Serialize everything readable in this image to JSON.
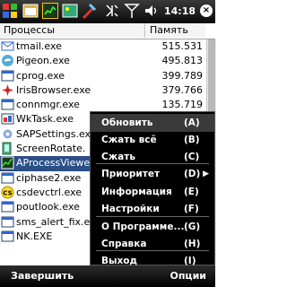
{
  "status_bar": {
    "time": "14:18",
    "close_glyph": "×"
  },
  "header": {
    "col_process": "Процессы",
    "col_memory": "Память"
  },
  "processes": [
    {
      "name": "tmail.exe",
      "memory": "515.531",
      "icon": "mail-icon"
    },
    {
      "name": "Pigeon.exe",
      "memory": "495.813",
      "icon": "pigeon-icon"
    },
    {
      "name": "cprog.exe",
      "memory": "399.789",
      "icon": "window-icon"
    },
    {
      "name": "IrisBrowser.exe",
      "memory": "379.766",
      "icon": "iris-icon"
    },
    {
      "name": "connmgr.exe",
      "memory": "135.719",
      "icon": "window-icon"
    },
    {
      "name": "WkTask.exe",
      "memory": "",
      "icon": "task-icon"
    },
    {
      "name": "SAPSettings.exe",
      "memory": "",
      "icon": "settings-icon"
    },
    {
      "name": "ScreenRotate.",
      "memory": "",
      "icon": "rotate-icon"
    },
    {
      "name": "AProcessViewer",
      "memory": "",
      "icon": "app-icon",
      "selected": true
    },
    {
      "name": "ciphase2.exe",
      "memory": "",
      "icon": "window-icon"
    },
    {
      "name": "csdevctrl.exe",
      "memory": "",
      "icon": "cs-icon"
    },
    {
      "name": "poutlook.exe",
      "memory": "",
      "icon": "window-icon"
    },
    {
      "name": "sms_alert_fix.e",
      "memory": "",
      "icon": "window-icon"
    },
    {
      "name": "NK.EXE",
      "memory": "",
      "icon": "window-icon"
    }
  ],
  "menu": [
    {
      "label": "Обновить",
      "key": "(A)",
      "active": true
    },
    {
      "label": "Сжать всё",
      "key": "(B)"
    },
    {
      "label": "Сжать",
      "key": "(C)"
    },
    {
      "label": "Приоритет",
      "key": "(D)",
      "submenu": true
    },
    {
      "label": "Информация",
      "key": "(E)"
    },
    {
      "label": "Настройки",
      "key": "(F)"
    },
    {
      "label": "О Программе...",
      "key": "(G)"
    },
    {
      "label": "Справка",
      "key": "(H)"
    },
    {
      "label": "Выход",
      "key": "(I)"
    }
  ],
  "softkeys": {
    "left": "Завершить",
    "right": "Опции"
  },
  "colors": {
    "selection": "#2b4f86",
    "menu_bg": "#000000"
  }
}
